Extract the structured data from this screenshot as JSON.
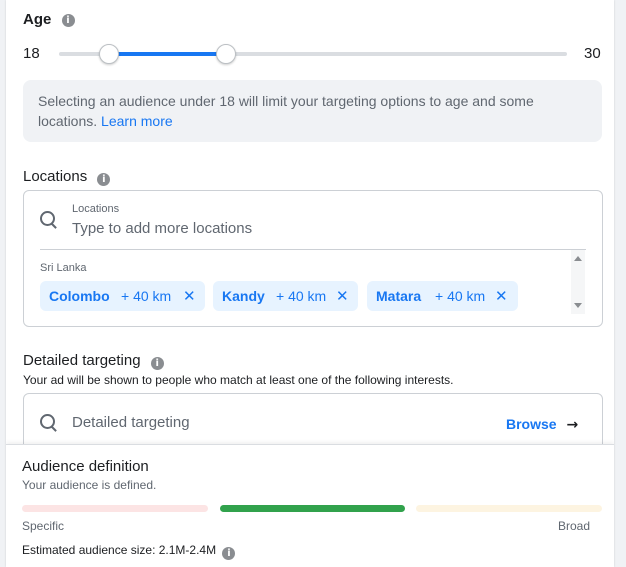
{
  "age": {
    "title": "Age",
    "min_label": "18",
    "max_label": "30",
    "range_min": 13,
    "range_max": 65,
    "value_min": 18,
    "value_max": 30
  },
  "notice": {
    "text": "Selecting an audience under 18 will limit your targeting options to age and some locations.",
    "link": "Learn more"
  },
  "locations": {
    "title": "Locations",
    "input_label": "Locations",
    "placeholder": "Type to add more locations",
    "country": "Sri Lanka",
    "chips": [
      {
        "name": "Colombo",
        "radius": "+ 40 km"
      },
      {
        "name": "Kandy",
        "radius": "+ 40 km"
      },
      {
        "name": "Matara",
        "radius": "+ 40 km"
      }
    ]
  },
  "detailed": {
    "title": "Detailed targeting",
    "subtitle": "Your ad will be shown to people who match at least one of the following interests.",
    "placeholder": "Detailed targeting",
    "browse": "Browse"
  },
  "audience": {
    "title": "Audience definition",
    "status": "Your audience is defined.",
    "left_label": "Specific",
    "right_label": "Broad",
    "estimate_label": "Estimated audience size: 2.1M-2.4M",
    "colors": {
      "specific": "#fce4e4",
      "defined": "#31a24c",
      "broad": "#fdf4e1"
    }
  },
  "icons": {
    "info": "i",
    "close": "✕",
    "arrow": "→"
  }
}
